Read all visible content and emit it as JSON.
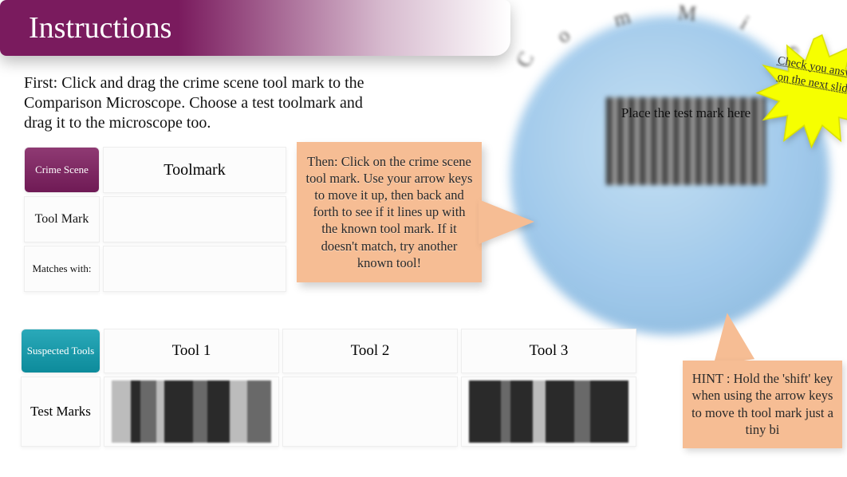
{
  "title": "Instructions",
  "first_text": "First:    Click and drag the crime scene tool mark to the Comparison Microscope. Choose a test toolmark and drag it to the microscope too.",
  "then_text": "Then:    Click on the crime scene tool mark. Use your arrow keys to move it up, then back and forth to see if it lines up with the known tool mark.\nIf it doesn't match, try another known tool!",
  "hint_text": "HINT : Hold the 'shift' key when using the arrow keys to move th tool mark just a tiny bi",
  "crime_table": {
    "header": "Crime Scene",
    "row1_label": "Tool Mark",
    "row2_label": "Matches with:",
    "toolmark_label": "Toolmark"
  },
  "tools_table": {
    "header": "Suspected Tools",
    "row_label": "Test Marks",
    "tools": [
      "Tool 1",
      "Tool 2",
      "Tool 3"
    ]
  },
  "microscope": {
    "arc_text": "Comparison Microscope",
    "place_text": "Place the test mark here"
  },
  "star_text": "Check you answer on the next slide!"
}
